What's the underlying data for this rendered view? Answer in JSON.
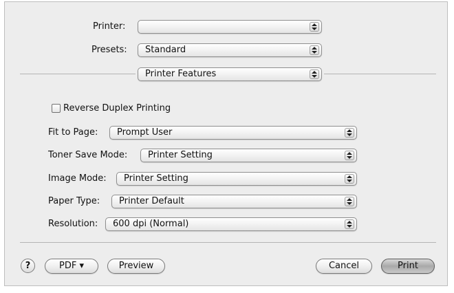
{
  "printer": {
    "label": "Printer:",
    "value": ""
  },
  "presets": {
    "label": "Presets:",
    "value": "Standard"
  },
  "section": {
    "value": "Printer Features"
  },
  "reverse_duplex": {
    "label": "Reverse Duplex Printing",
    "checked": false
  },
  "fit_to_page": {
    "label": "Fit to Page:",
    "value": "Prompt User"
  },
  "toner_save_mode": {
    "label": "Toner Save Mode:",
    "value": "Printer Setting"
  },
  "image_mode": {
    "label": "Image Mode:",
    "value": "Printer Setting"
  },
  "paper_type": {
    "label": "Paper Type:",
    "value": "Printer Default"
  },
  "resolution": {
    "label": "Resolution:",
    "value": "600 dpi (Normal)"
  },
  "buttons": {
    "help": "?",
    "pdf": "PDF ▾",
    "preview": "Preview",
    "cancel": "Cancel",
    "print": "Print"
  }
}
